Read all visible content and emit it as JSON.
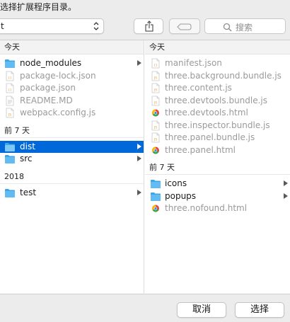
{
  "dialog": {
    "title": "选择扩展程序目录。",
    "location_value": "t",
    "search_placeholder": "搜索"
  },
  "columns": [
    {
      "sections": [
        {
          "header": "今天",
          "items": [
            {
              "name": "node_modules",
              "type": "folder",
              "has_children": true
            },
            {
              "name": "package-lock.json",
              "type": "json",
              "dim": true
            },
            {
              "name": "package.json",
              "type": "json",
              "dim": true
            },
            {
              "name": "README.MD",
              "type": "doc",
              "dim": true
            },
            {
              "name": "webpack.config.js",
              "type": "js",
              "dim": true
            }
          ]
        },
        {
          "header": "前 7 天",
          "items": [
            {
              "name": "dist",
              "type": "folder",
              "has_children": true,
              "selected": true
            },
            {
              "name": "src",
              "type": "folder",
              "has_children": true
            }
          ]
        },
        {
          "header": "2018",
          "items": [
            {
              "name": "test",
              "type": "folder",
              "has_children": true
            }
          ]
        }
      ]
    },
    {
      "sections": [
        {
          "header": "今天",
          "items": [
            {
              "name": "manifest.json",
              "type": "json",
              "dim": true
            },
            {
              "name": "three.background.bundle.js",
              "type": "js",
              "dim": true
            },
            {
              "name": "three.content.js",
              "type": "js",
              "dim": true
            },
            {
              "name": "three.devtools.bundle.js",
              "type": "js",
              "dim": true
            },
            {
              "name": "three.devtools.html",
              "type": "html",
              "dim": true
            },
            {
              "name": "three.inspector.bundle.js",
              "type": "js",
              "dim": true
            },
            {
              "name": "three.panel.bundle.js",
              "type": "js",
              "dim": true
            },
            {
              "name": "three.panel.html",
              "type": "html",
              "dim": true
            }
          ]
        },
        {
          "header": "前 7 天",
          "items": [
            {
              "name": "icons",
              "type": "folder",
              "has_children": true
            },
            {
              "name": "popups",
              "type": "folder",
              "has_children": true
            },
            {
              "name": "three.nofound.html",
              "type": "html",
              "dim": true
            }
          ]
        }
      ]
    }
  ],
  "buttons": {
    "cancel": "取消",
    "choose": "选择"
  },
  "colors": {
    "selection": "#0068d9",
    "folder": "#3aa7ea",
    "dim_text": "#9a9a9a"
  }
}
